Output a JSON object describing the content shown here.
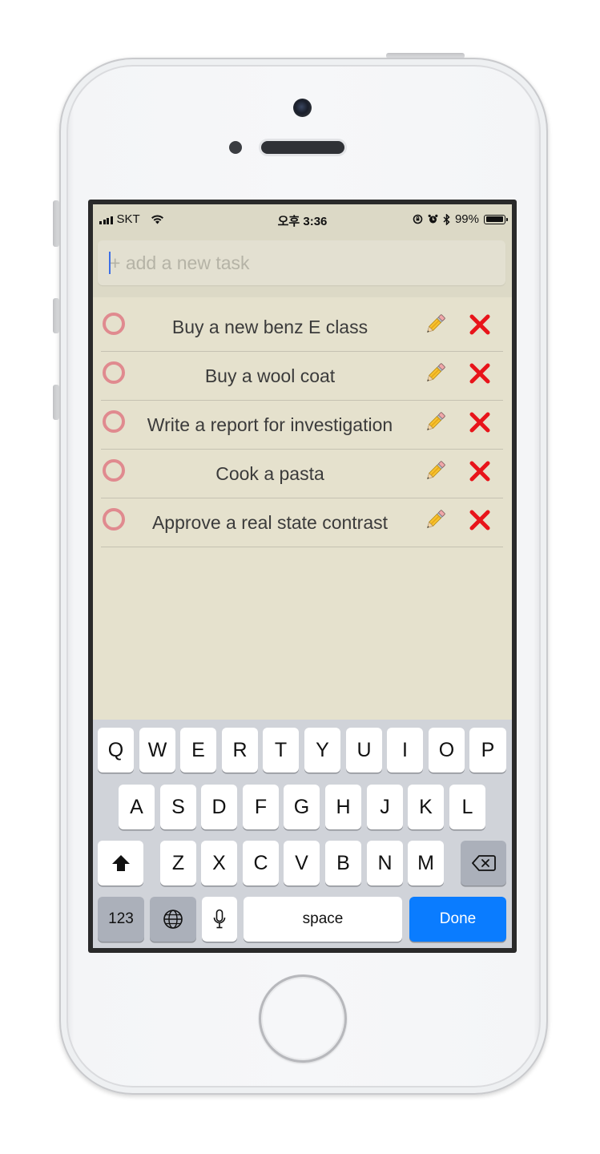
{
  "status_bar": {
    "carrier": "SKT",
    "time": "오후 3:36",
    "battery": "99%",
    "icons": [
      "signal-icon",
      "wifi-icon",
      "rotation-lock-icon",
      "alarm-icon",
      "bluetooth-icon",
      "battery-icon"
    ]
  },
  "task_input": {
    "placeholder": "+ add a new task",
    "value": ""
  },
  "tasks": [
    {
      "text": "Buy a new benz E class",
      "completed": false
    },
    {
      "text": "Buy a wool coat",
      "completed": false
    },
    {
      "text": "Write a report for investigation",
      "completed": false
    },
    {
      "text": "Cook a pasta",
      "completed": false
    },
    {
      "text": "Approve a real state contrast",
      "completed": false
    }
  ],
  "task_actions": {
    "edit_icon": "pencil-icon",
    "delete_icon": "close-icon"
  },
  "keyboard": {
    "row1": [
      "Q",
      "W",
      "E",
      "R",
      "T",
      "Y",
      "U",
      "I",
      "O",
      "P"
    ],
    "row2": [
      "A",
      "S",
      "D",
      "F",
      "G",
      "H",
      "J",
      "K",
      "L"
    ],
    "row3": [
      "Z",
      "X",
      "C",
      "V",
      "B",
      "N",
      "M"
    ],
    "numbers_key": "123",
    "space_key": "space",
    "done_key": "Done"
  },
  "colors": {
    "app_background": "#e5e1cd",
    "check_circle": "#e08a8f",
    "delete_x": "#e8141a",
    "done_key": "#0a7cff"
  }
}
